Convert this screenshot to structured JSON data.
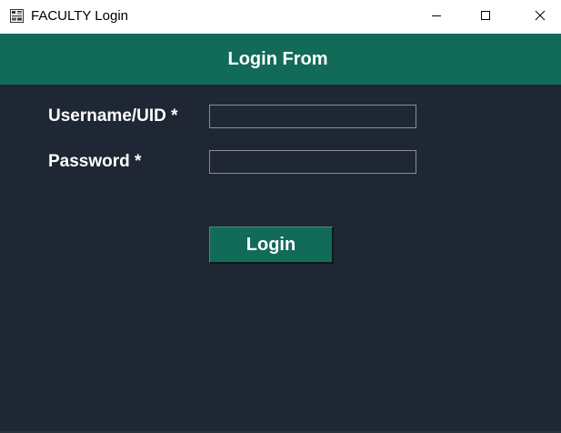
{
  "window": {
    "title": "FACULTY Login",
    "app_icon": "app-window-icon",
    "controls": {
      "minimize_icon": "minimize-icon",
      "maximize_icon": "maximize-icon",
      "close_icon": "close-icon"
    }
  },
  "header": {
    "title": "Login From"
  },
  "form": {
    "username_label": "Username/UID *",
    "username_value": "",
    "password_label": "Password *",
    "password_value": "",
    "login_label": "Login"
  },
  "colors": {
    "background": "#1e2733",
    "accent": "#126b58",
    "text": "#ffffff",
    "input_border": "#8a9099"
  }
}
